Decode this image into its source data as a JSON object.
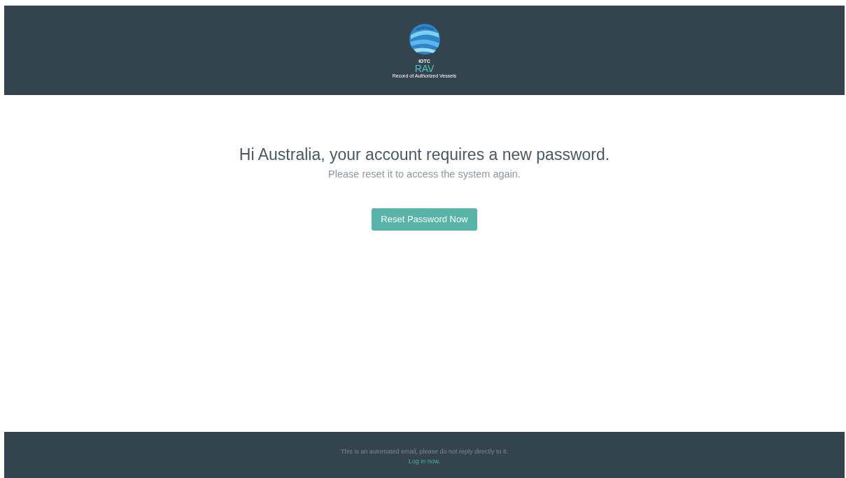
{
  "header": {
    "org": "IOTC",
    "app": "RAV",
    "subtitle": "Record of Authorized Vessels"
  },
  "message": {
    "heading": "Hi Australia, your account requires a new password.",
    "subheading": "Please reset it to access the system again."
  },
  "button": {
    "label": "Reset Password Now"
  },
  "footer": {
    "note": "This is an automated email, please do not reply directly to it.",
    "link": "Log in now."
  }
}
